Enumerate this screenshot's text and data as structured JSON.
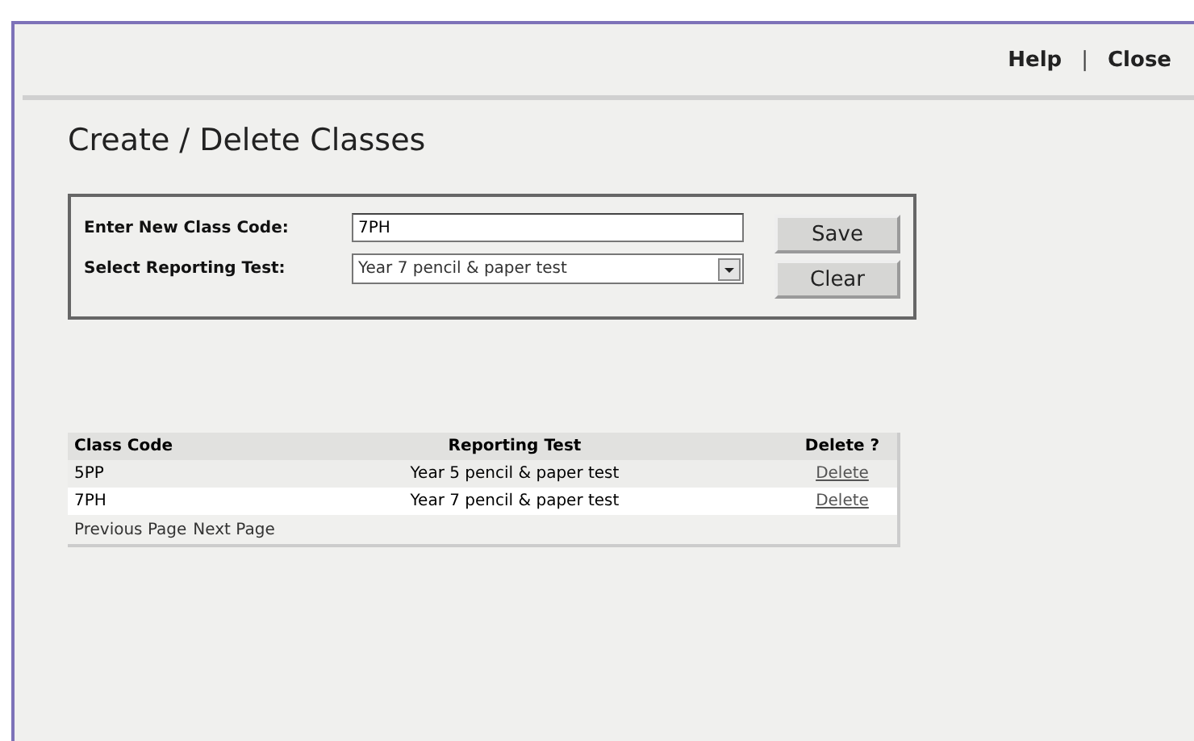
{
  "header": {
    "links": [
      "Help",
      "Close"
    ],
    "separator": "|"
  },
  "title": "Create / Delete Classes",
  "form": {
    "class_code": {
      "label": "Enter New Class Code:",
      "value": "7PH"
    },
    "reporting_test": {
      "label": "Select Reporting Test:",
      "value": "Year 7 pencil & paper test"
    },
    "buttons": [
      "Save",
      "Clear"
    ]
  },
  "table": {
    "columns": [
      "Class Code",
      "Reporting Test",
      "Delete ?"
    ],
    "rows": [
      {
        "class_code": "5PP",
        "reporting_test": "Year 5 pencil & paper test",
        "action": "Delete"
      },
      {
        "class_code": "7PH",
        "reporting_test": "Year 7 pencil & paper test",
        "action": "Delete"
      }
    ],
    "pager": [
      "Previous Page",
      "Next Page"
    ]
  }
}
